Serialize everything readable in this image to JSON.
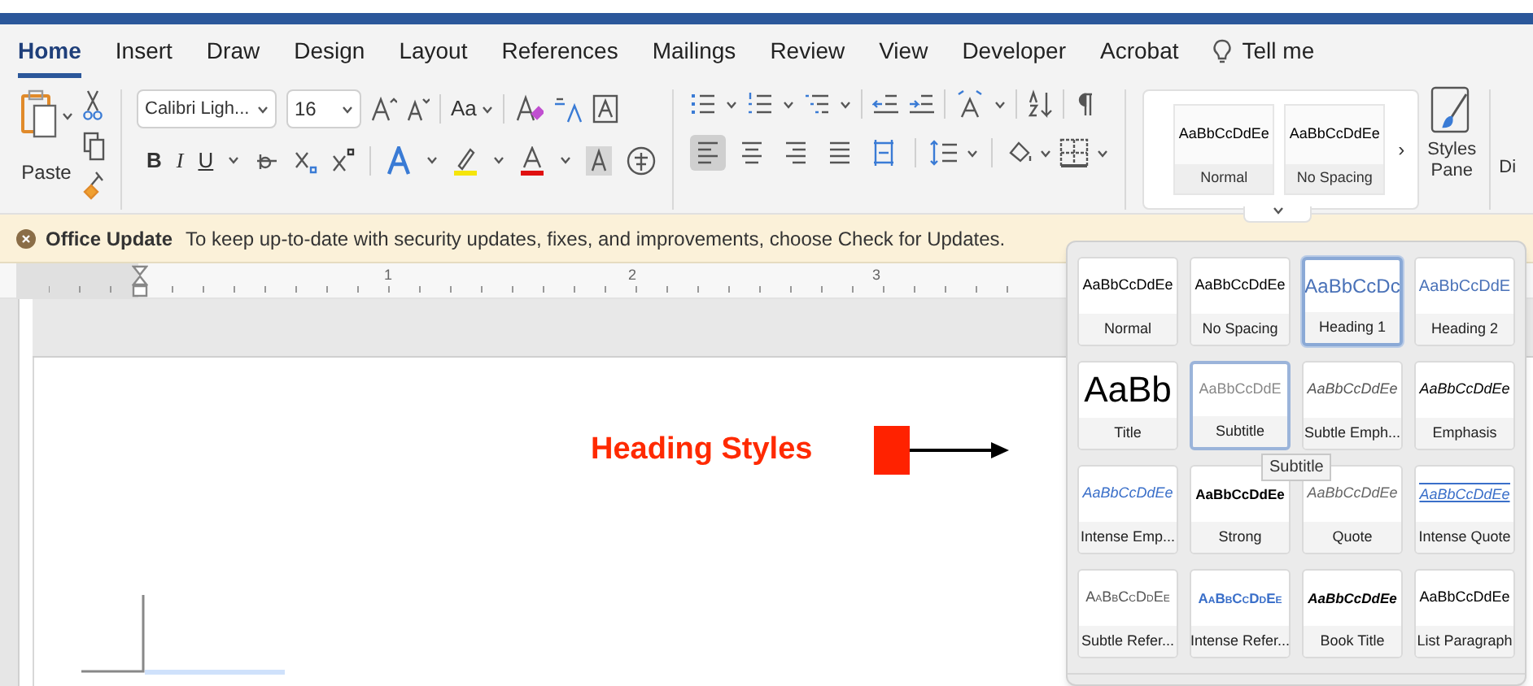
{
  "tabs": [
    {
      "label": "Home",
      "selected": true
    },
    {
      "label": "Insert",
      "selected": false
    },
    {
      "label": "Draw",
      "selected": false
    },
    {
      "label": "Design",
      "selected": false
    },
    {
      "label": "Layout",
      "selected": false
    },
    {
      "label": "References",
      "selected": false
    },
    {
      "label": "Mailings",
      "selected": false
    },
    {
      "label": "Review",
      "selected": false
    },
    {
      "label": "View",
      "selected": false
    },
    {
      "label": "Developer",
      "selected": false
    },
    {
      "label": "Acrobat",
      "selected": false
    }
  ],
  "tell_me": "Tell me",
  "ribbon": {
    "paste_label": "Paste",
    "font_name": "Calibri Ligh...",
    "font_size": "16",
    "change_case": "Aa",
    "format_buttons": [
      {
        "label": "B",
        "kind": "bold"
      },
      {
        "label": "I",
        "kind": "italic"
      },
      {
        "label": "U",
        "kind": "underline"
      }
    ],
    "alignment": [
      {
        "kind": "left",
        "selected": true
      },
      {
        "kind": "center",
        "selected": false
      },
      {
        "kind": "right",
        "selected": false
      },
      {
        "kind": "justify",
        "selected": false
      },
      {
        "kind": "distributed",
        "selected": false
      }
    ],
    "gallery": [
      {
        "preview": "AaBbCcDdEe",
        "name": "Normal"
      },
      {
        "preview": "AaBbCcDdEe",
        "name": "No Spacing"
      }
    ],
    "next_arrow": "›",
    "styles_pane": "Styles Pane",
    "cut_off": "Di"
  },
  "update_bar": {
    "title": "Office Update",
    "message": "To keep up-to-date with security updates, fixes, and improvements, choose Check for Updates."
  },
  "ruler": [
    "1",
    "2",
    "3"
  ],
  "document": {
    "annotation": "Heading Styles"
  },
  "styles_popup": [
    {
      "preview": "AaBbCcDdEe",
      "name": "Normal",
      "kind": "normal",
      "selected": false,
      "hovered": false
    },
    {
      "preview": "AaBbCcDdEe",
      "name": "No Spacing",
      "kind": "normal",
      "selected": false,
      "hovered": false
    },
    {
      "preview": "AaBbCcDc",
      "name": "Heading 1",
      "kind": "heading1",
      "selected": true,
      "hovered": false
    },
    {
      "preview": "AaBbCcDdE",
      "name": "Heading 2",
      "kind": "heading2",
      "selected": false,
      "hovered": false
    },
    {
      "preview": "AaBb",
      "name": "Title",
      "kind": "title",
      "selected": false,
      "hovered": false
    },
    {
      "preview": "AaBbCcDdE",
      "name": "Subtitle",
      "kind": "subtitle",
      "selected": false,
      "hovered": true
    },
    {
      "preview": "AaBbCcDdEe",
      "name": "Subtle Emph...",
      "kind": "subtle_emphasis",
      "selected": false,
      "hovered": false
    },
    {
      "preview": "AaBbCcDdEe",
      "name": "Emphasis",
      "kind": "emphasis",
      "selected": false,
      "hovered": false
    },
    {
      "preview": "AaBbCcDdEe",
      "name": "Intense Emp...",
      "kind": "intense_emphasis",
      "selected": false,
      "hovered": false
    },
    {
      "preview": "AaBbCcDdEe",
      "name": "Strong",
      "kind": "strong",
      "selected": false,
      "hovered": false
    },
    {
      "preview": "AaBbCcDdEe",
      "name": "Quote",
      "kind": "quote",
      "selected": false,
      "hovered": false
    },
    {
      "preview": "AaBbCcDdEe",
      "name": "Intense Quote",
      "kind": "intense_quote",
      "selected": false,
      "hovered": false
    },
    {
      "preview": "AaBbCcDdEe",
      "name": "Subtle Refer...",
      "kind": "subtle_reference",
      "selected": false,
      "hovered": false
    },
    {
      "preview": "AaBbCcDdEe",
      "name": "Intense Refer...",
      "kind": "intense_reference",
      "selected": false,
      "hovered": false
    },
    {
      "preview": "AaBbCcDdEe",
      "name": "Book Title",
      "kind": "book_title",
      "selected": false,
      "hovered": false
    },
    {
      "preview": "AaBbCcDdEe",
      "name": "List Paragraph",
      "kind": "normal",
      "selected": false,
      "hovered": false
    }
  ],
  "tooltip": "Subtitle"
}
